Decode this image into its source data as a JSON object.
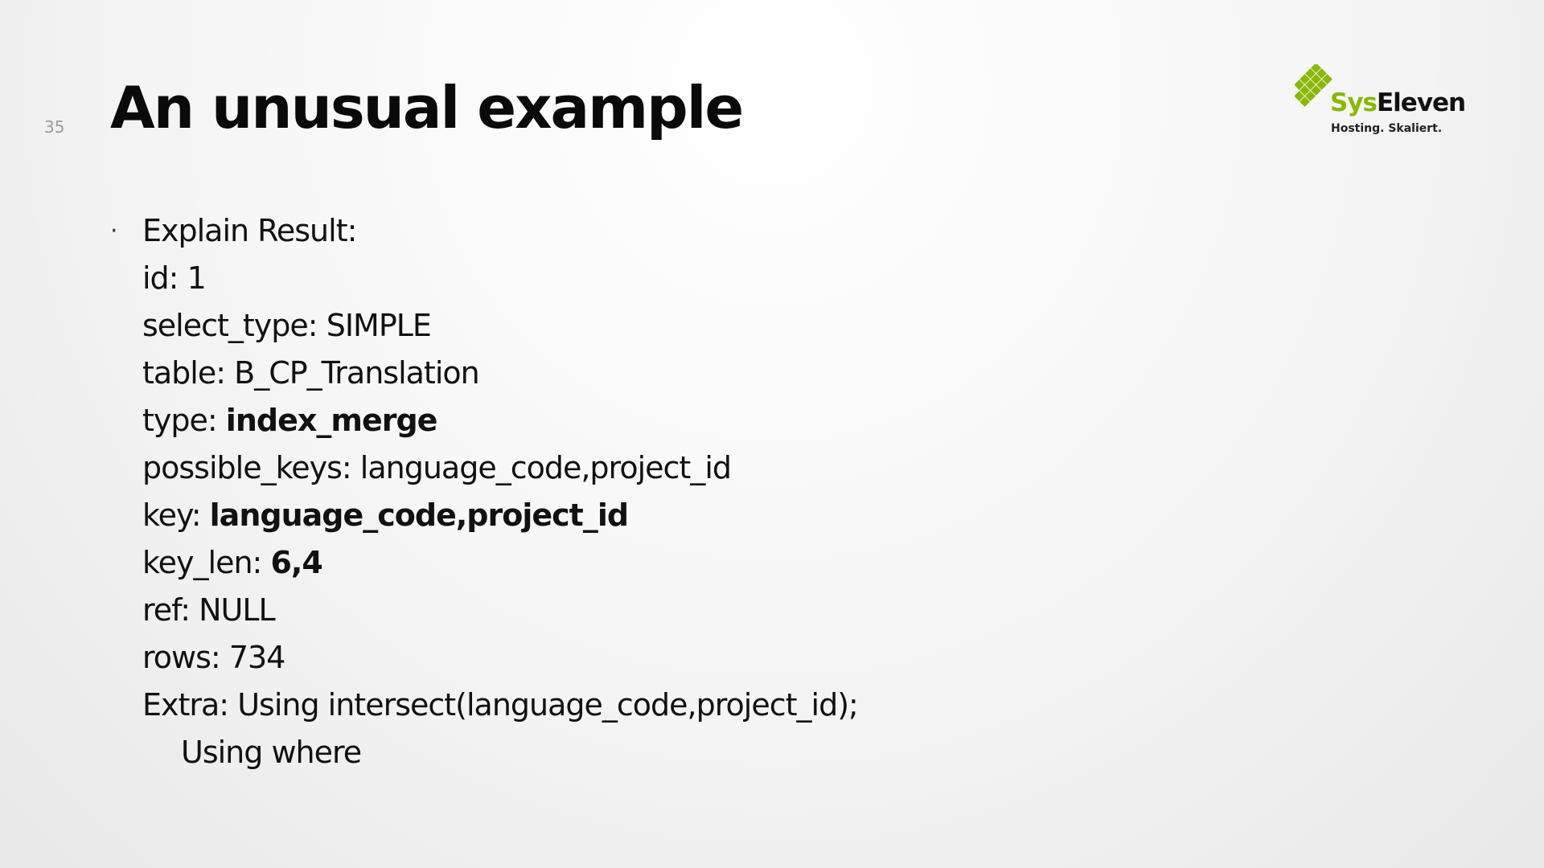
{
  "slide": {
    "number": "35",
    "title": "An unusual example"
  },
  "logo": {
    "name_part1": "Sys",
    "name_part2": "Eleven",
    "tagline": "Hosting. Skaliert.",
    "accent_color": "#8ab800"
  },
  "bullet": {
    "heading": "Explain Result:",
    "fields": {
      "id": {
        "label": "id:",
        "value": "1"
      },
      "select_type": {
        "label": "select_type:",
        "value": "SIMPLE"
      },
      "table": {
        "label": "table:",
        "value": "B_CP_Translation"
      },
      "type": {
        "label": "type:",
        "value": "index_merge"
      },
      "possible_keys": {
        "label": "possible_keys:",
        "value": "language_code,project_id"
      },
      "key": {
        "label": "key:",
        "value": "language_code,project_id"
      },
      "key_len": {
        "label": "key_len:",
        "value": "6,4"
      },
      "ref": {
        "label": "ref:",
        "value": "NULL"
      },
      "rows": {
        "label": "rows:",
        "value": "734"
      },
      "extra": {
        "label": "Extra:",
        "value": "Using intersect(language_code,project_id);",
        "continuation": "Using where"
      }
    }
  }
}
